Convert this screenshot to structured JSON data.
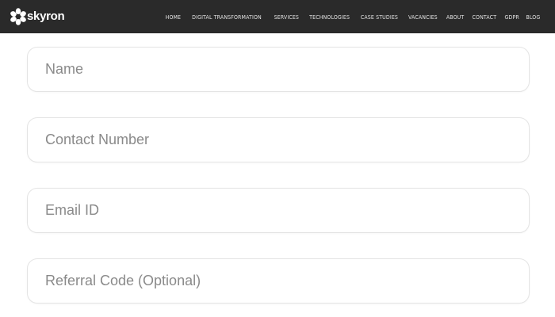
{
  "brand": {
    "name": "skyron",
    "logo_icon": "flower-logo-icon",
    "nav_bg": "#2a2a2a"
  },
  "nav": {
    "items": [
      {
        "label": "HOME"
      },
      {
        "label": "DIGITAL TRANSFORMATION"
      },
      {
        "label": "SERVICES"
      },
      {
        "label": "TECHNOLOGIES"
      },
      {
        "label": "CASE STUDIES"
      },
      {
        "label": "VACANCIES"
      },
      {
        "label": "ABOUT"
      },
      {
        "label": "CONTACT"
      },
      {
        "label": "GDPR"
      },
      {
        "label": "BLOG"
      }
    ]
  },
  "form": {
    "name": {
      "placeholder": "Name",
      "value": ""
    },
    "contact": {
      "placeholder": "Contact Number",
      "value": ""
    },
    "email": {
      "placeholder": "Email ID",
      "value": ""
    },
    "referral": {
      "placeholder": "Referral Code (Optional)",
      "value": ""
    }
  }
}
